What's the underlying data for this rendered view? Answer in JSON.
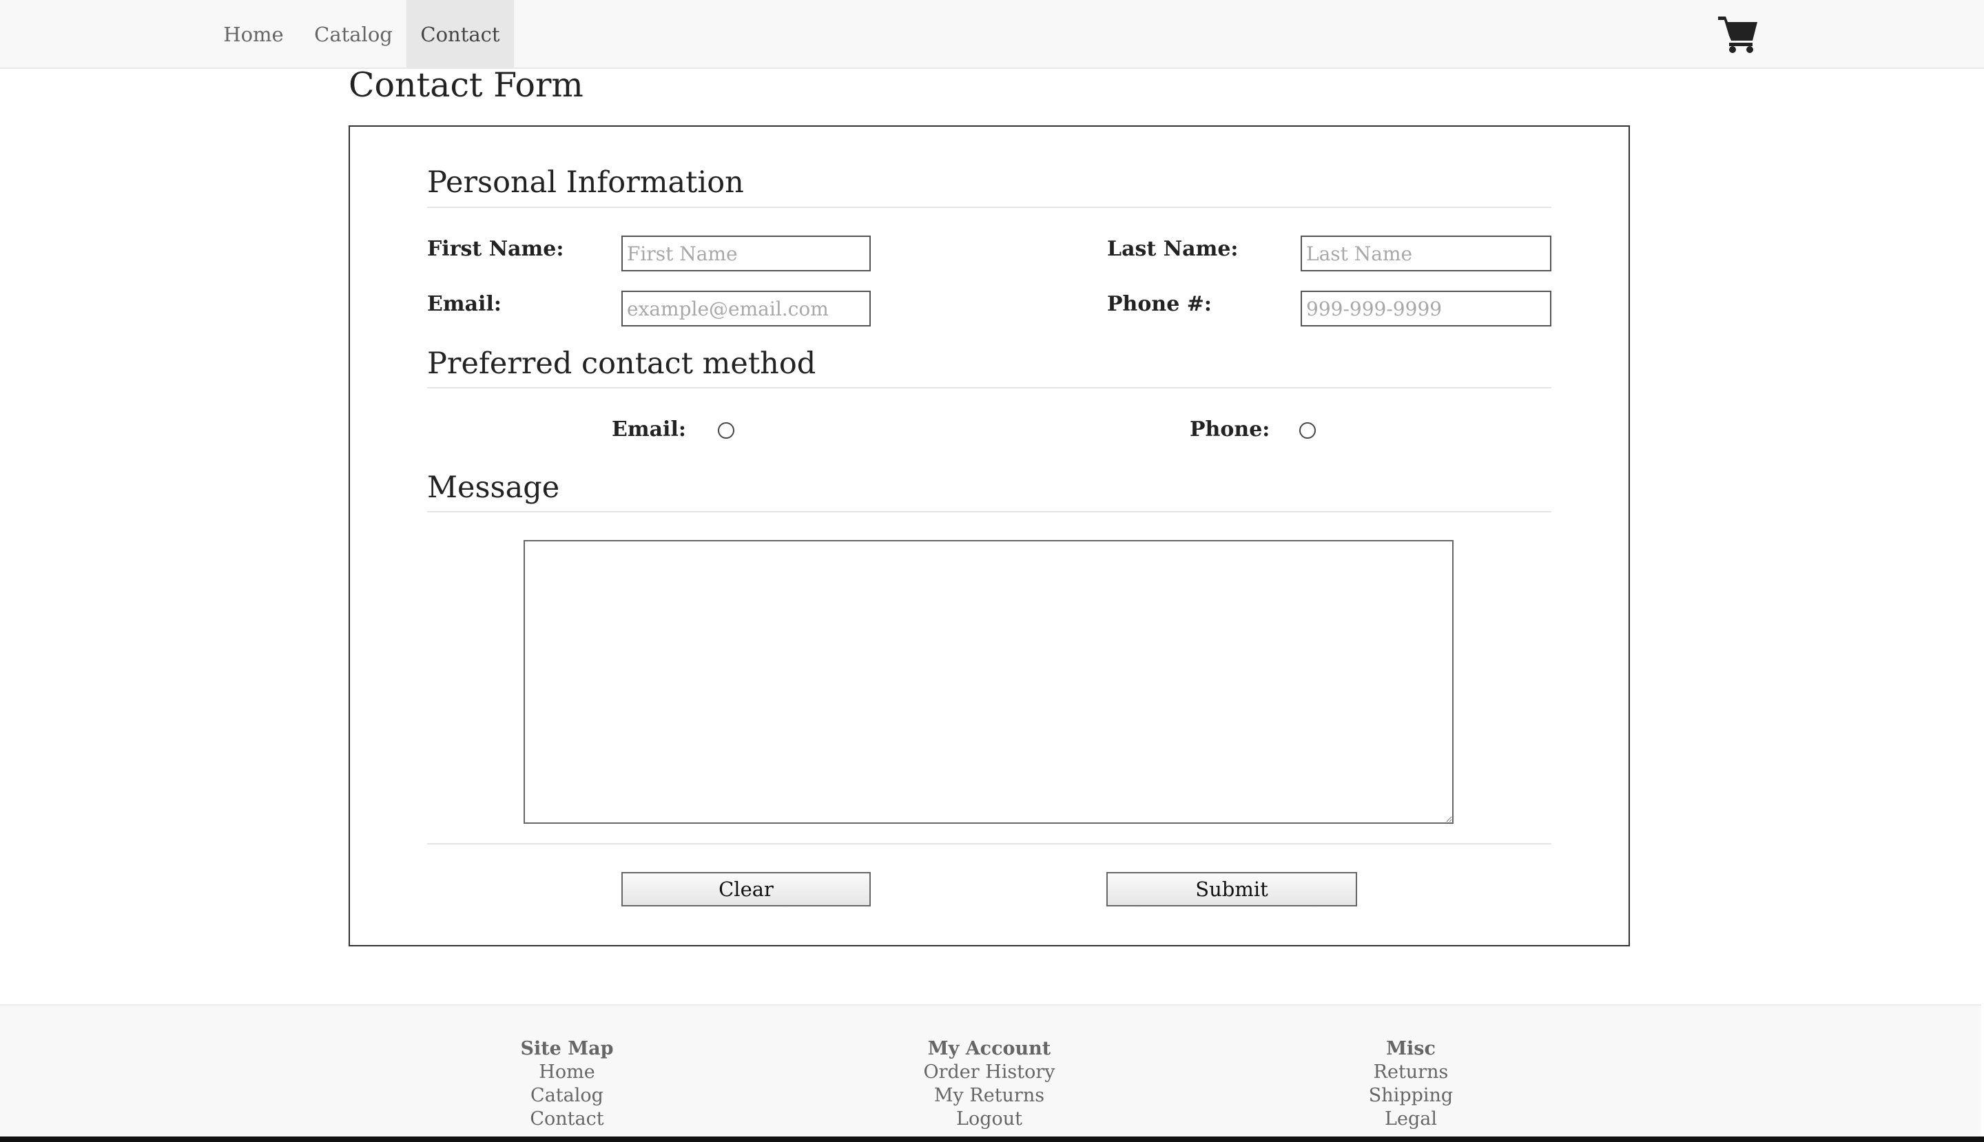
{
  "nav": {
    "items": [
      {
        "label": "Home",
        "active": false
      },
      {
        "label": "Catalog",
        "active": false
      },
      {
        "label": "Contact",
        "active": true
      }
    ],
    "cart_icon": "shopping-cart-icon"
  },
  "page": {
    "title": "Contact Form"
  },
  "form": {
    "personal": {
      "heading": "Personal Information",
      "first_name": {
        "label": "First Name:",
        "placeholder": "First Name",
        "value": ""
      },
      "last_name": {
        "label": "Last Name:",
        "placeholder": "Last Name",
        "value": ""
      },
      "email": {
        "label": "Email:",
        "placeholder": "example@email.com",
        "value": ""
      },
      "phone": {
        "label": "Phone #:",
        "placeholder": "999-999-9999",
        "value": ""
      }
    },
    "contact_method": {
      "heading": "Preferred contact method",
      "options": [
        {
          "label": "Email:",
          "checked": false
        },
        {
          "label": "Phone:",
          "checked": false
        }
      ]
    },
    "message": {
      "heading": "Message",
      "value": ""
    },
    "buttons": {
      "clear": "Clear",
      "submit": "Submit"
    }
  },
  "footer": {
    "columns": [
      {
        "heading": "Site Map",
        "links": [
          "Home",
          "Catalog",
          "Contact"
        ]
      },
      {
        "heading": "My Account",
        "links": [
          "Order History",
          "My Returns",
          "Logout"
        ]
      },
      {
        "heading": "Misc",
        "links": [
          "Returns",
          "Shipping",
          "Legal"
        ]
      }
    ]
  }
}
